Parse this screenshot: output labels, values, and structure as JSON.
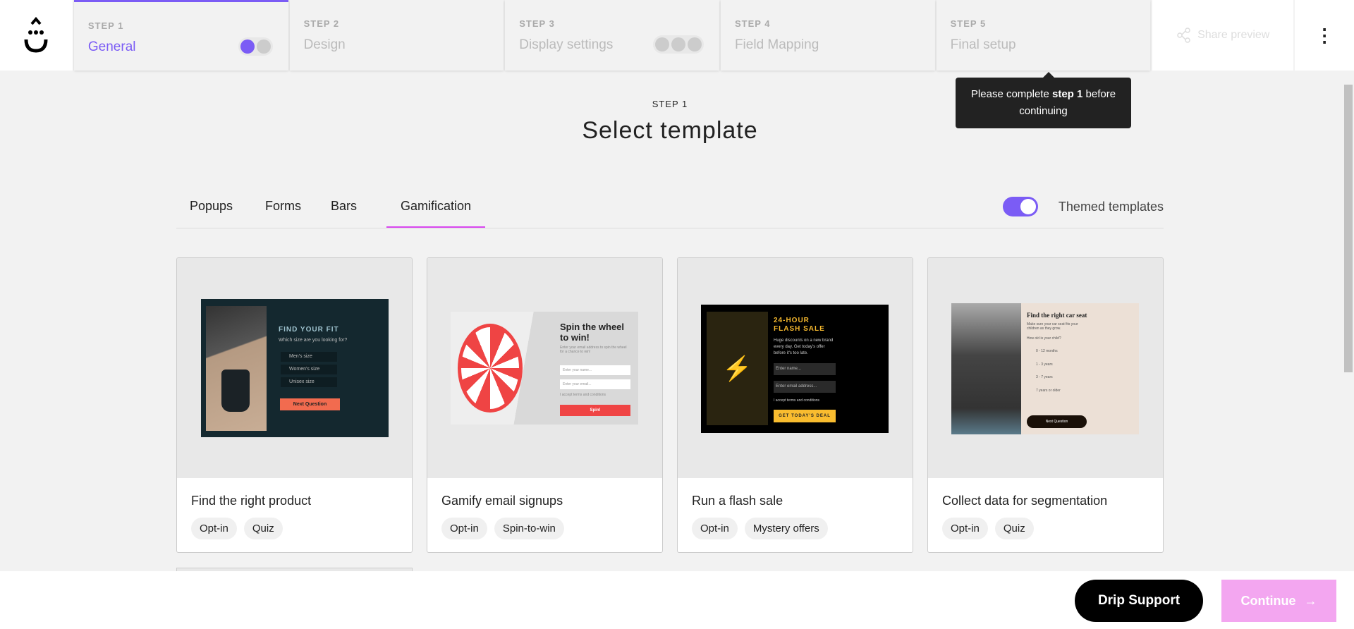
{
  "header": {
    "steps": [
      {
        "label": "STEP 1",
        "name": "General",
        "dots": 2,
        "done": 1
      },
      {
        "label": "STEP 2",
        "name": "Design"
      },
      {
        "label": "STEP 3",
        "name": "Display settings",
        "dots": 3,
        "done": 0
      },
      {
        "label": "STEP 4",
        "name": "Field Mapping"
      },
      {
        "label": "STEP 5",
        "name": "Final setup"
      }
    ],
    "share_preview": "Share preview",
    "menu_icon": "more-vertical-icon"
  },
  "tooltip": {
    "pre": "Please complete ",
    "bold": "step 1",
    "post": " before continuing"
  },
  "main": {
    "kicker": "STEP 1",
    "title": "Select template",
    "tabs": [
      "Popups",
      "Forms",
      "Bars",
      "Gamification"
    ],
    "selected_tab": "Gamification",
    "themed_label": "Themed templates",
    "themed_on": true,
    "cards": [
      {
        "title": "Find the right product",
        "tags": [
          "Opt-in",
          "Quiz"
        ],
        "preview": {
          "heading": "FIND YOUR FIT",
          "sub": "Which size are you looking for?",
          "options": [
            "Men's size",
            "Women's size",
            "Unisex size"
          ],
          "button": "Next Question"
        }
      },
      {
        "title": "Gamify email signups",
        "tags": [
          "Opt-in",
          "Spin-to-win"
        ],
        "preview": {
          "heading": "Spin the wheel to win!",
          "sub": "Enter your email address to spin the wheel for a chance to win!",
          "name_ph": "Enter your name...",
          "email_ph": "Enter your email...",
          "accept": "I accept terms and conditions",
          "button": "Spin!"
        }
      },
      {
        "title": "Run a flash sale",
        "tags": [
          "Opt-in",
          "Mystery offers"
        ],
        "preview": {
          "heading": "24-HOUR FLASH SALE",
          "sub": "Huge discounts on a new brand every day. Get today's offer before it's too late.",
          "name_ph": "Enter name...",
          "email_ph": "Enter email address...",
          "accept": "I accept terms and conditions",
          "button": "GET TODAY'S DEAL"
        }
      },
      {
        "title": "Collect data for segmentation",
        "tags": [
          "Opt-in",
          "Quiz"
        ],
        "preview": {
          "heading": "Find the right car seat",
          "sub": "Make sure your car seat fits your children as they grow.",
          "question": "How old is your child?",
          "options": [
            "0 - 12 months",
            "1 - 3 years",
            "3 - 7 years",
            "7 years or older"
          ],
          "button": "Next Question"
        }
      }
    ]
  },
  "footer": {
    "support": "Drip Support",
    "continue": "Continue"
  },
  "colors": {
    "accent": "#7b5cf5",
    "tab_underline": "#d946ef",
    "continue_disabled": "#f3a6f0"
  }
}
